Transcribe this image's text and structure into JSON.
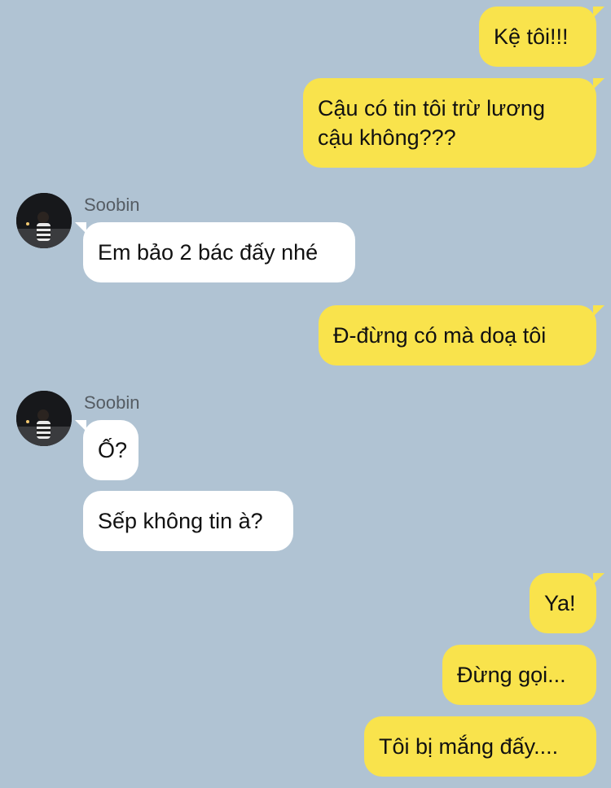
{
  "contact": {
    "name": "Soobin",
    "avatar_icon": "profile-photo-icon"
  },
  "colors": {
    "background": "#b0c3d3",
    "outgoing_bubble": "#f9e34c",
    "incoming_bubble": "#ffffff"
  },
  "messages": [
    {
      "direction": "out",
      "text": "Kệ tôi!!!"
    },
    {
      "direction": "out",
      "line1": "Cậu có tin tôi trừ lương",
      "line2": "cậu không???"
    },
    {
      "direction": "in",
      "sender": "Soobin",
      "text": "Em bảo 2 bác đấy nhé"
    },
    {
      "direction": "out",
      "text": "Đ-đừng có mà doạ tôi"
    },
    {
      "direction": "in",
      "sender": "Soobin",
      "text": "Ố?"
    },
    {
      "direction": "in",
      "text": "Sếp không tin à?"
    },
    {
      "direction": "out",
      "text": "Ya!"
    },
    {
      "direction": "out",
      "text": "Đừng gọi..."
    },
    {
      "direction": "out",
      "text": "Tôi bị mắng đấy...."
    }
  ]
}
